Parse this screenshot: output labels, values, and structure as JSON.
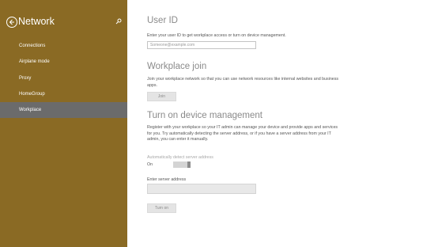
{
  "sidebar": {
    "title": "Network",
    "items": [
      {
        "label": "Connections",
        "selected": false
      },
      {
        "label": "Airplane mode",
        "selected": false
      },
      {
        "label": "Proxy",
        "selected": false
      },
      {
        "label": "HomeGroup",
        "selected": false
      },
      {
        "label": "Workplace",
        "selected": true
      }
    ],
    "accent_color": "#8a6a24"
  },
  "user_id": {
    "heading": "User ID",
    "description": "Enter your user ID to get workplace access or turn on device management.",
    "placeholder": "Someone@example.com",
    "value": ""
  },
  "workplace_join": {
    "heading": "Workplace join",
    "description": "Join your workplace network so that you can use network resources like internal websites and business apps.",
    "button_label": "Join"
  },
  "device_management": {
    "heading": "Turn on device management",
    "description": "Register with your workplace so your IT admin can manage your device and provide apps and services for you. Try automatically detecting the server address, or if you have a server address from your IT admin, you can enter it manually.",
    "auto_detect_label": "Automatically detect server address",
    "auto_detect_state": "On",
    "server_label": "Enter server address",
    "server_value": "",
    "button_label": "Turn on"
  }
}
